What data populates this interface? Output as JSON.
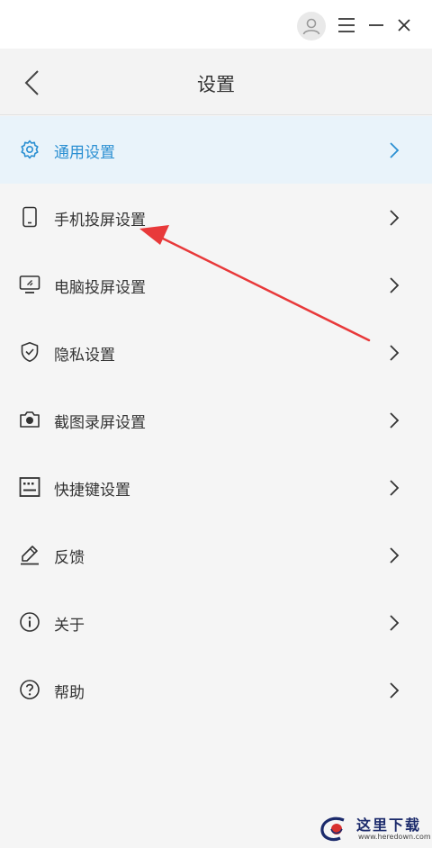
{
  "header": {
    "title": "设置"
  },
  "menu": {
    "items": [
      {
        "label": "通用设置",
        "icon": "gear-icon",
        "active": true
      },
      {
        "label": "手机投屏设置",
        "icon": "phone-icon"
      },
      {
        "label": "电脑投屏设置",
        "icon": "monitor-icon"
      },
      {
        "label": "隐私设置",
        "icon": "shield-icon"
      },
      {
        "label": "截图录屏设置",
        "icon": "camera-icon"
      },
      {
        "label": "快捷键设置",
        "icon": "keyboard-icon"
      },
      {
        "label": "反馈",
        "icon": "pen-icon"
      },
      {
        "label": "关于",
        "icon": "info-icon"
      },
      {
        "label": "帮助",
        "icon": "help-icon"
      }
    ]
  },
  "colors": {
    "accent": "#2a8fd2",
    "active_bg": "#e9f3fa",
    "annotation_arrow": "#e8393a"
  },
  "watermark": {
    "text": "这里下载",
    "url": "www.heredown.com"
  }
}
